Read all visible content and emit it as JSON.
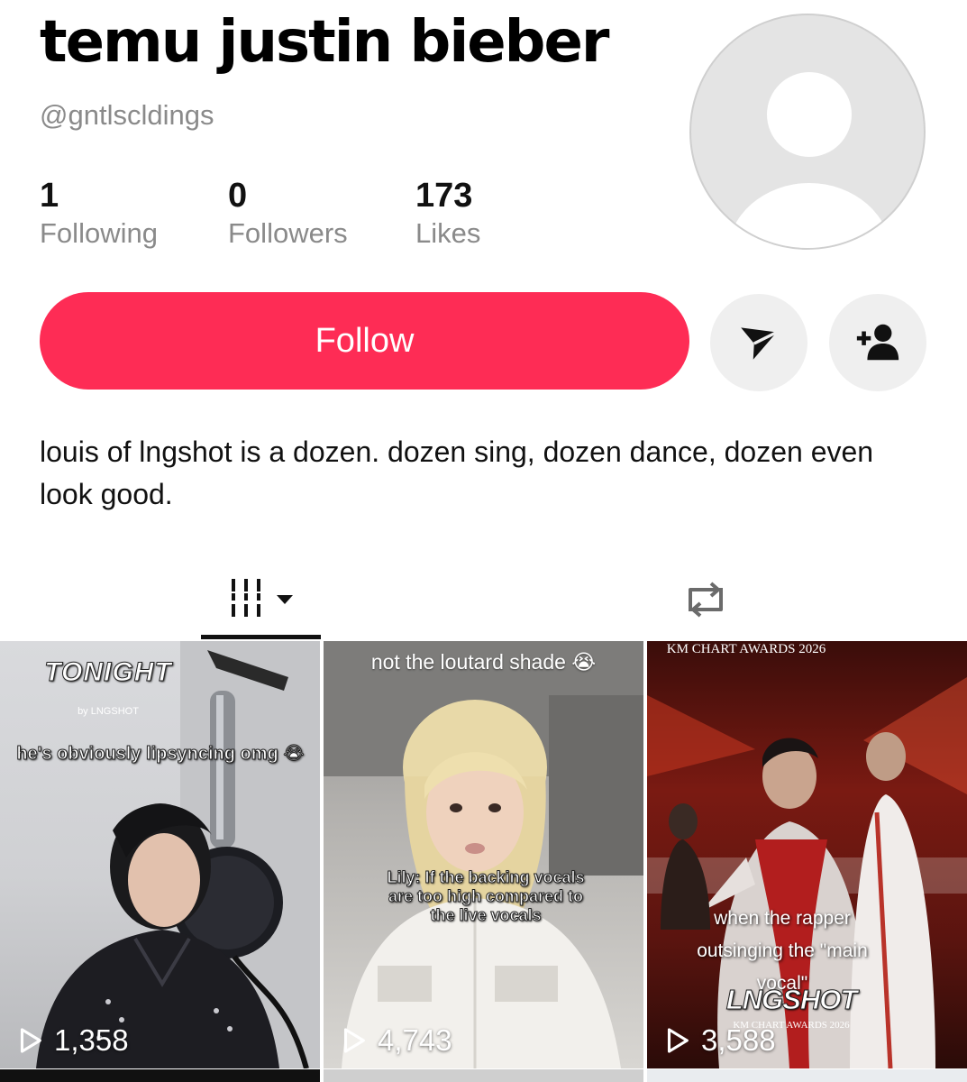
{
  "profile": {
    "display_name": "temu justin bieber",
    "username": "@gntlscldings",
    "bio": "louis of lngshot is a dozen. dozen sing, dozen dance, dozen even look good."
  },
  "stats": [
    {
      "value": "1",
      "label": "Following"
    },
    {
      "value": "0",
      "label": "Followers"
    },
    {
      "value": "173",
      "label": "Likes"
    }
  ],
  "actions": {
    "follow_label": "Follow",
    "message_icon": "paper-plane-icon",
    "add_friend_icon": "add-person-icon"
  },
  "tabs": [
    {
      "name": "videos",
      "icon": "grid-icon",
      "active": true
    },
    {
      "name": "reposts",
      "icon": "repost-icon",
      "active": false
    }
  ],
  "videos": [
    {
      "views": "1,358",
      "overlay_title": "TONIGHT",
      "overlay_sub": "by LNGSHOT",
      "caption": "he's obviously lipsyncing omg 😭"
    },
    {
      "views": "4,743",
      "caption_top": "not the loutard shade 😭",
      "caption": "Lily: If the backing vocals are too high compared to the live vocals"
    },
    {
      "views": "3,588",
      "overlay_title": "KM CHART AWARDS 2026",
      "caption": "when the rapper outsinging the \"main vocal\"",
      "brand": "LNGSHOT",
      "brand_sub": "KM CHART AWARDS 2026"
    }
  ],
  "colors": {
    "accent": "#fe2c55",
    "secondary_text": "#8a8a8a",
    "icon_button_bg": "#efefef"
  }
}
